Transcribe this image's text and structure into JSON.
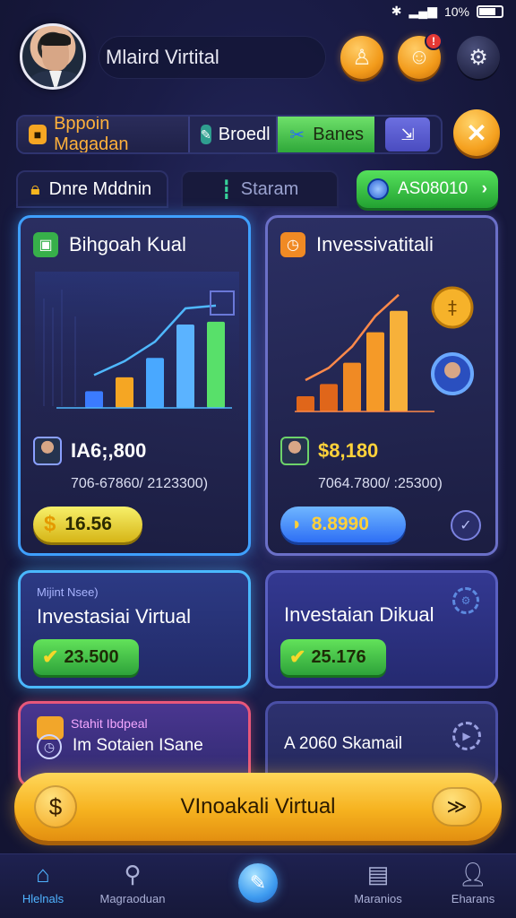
{
  "status_bar": {
    "battery": "10%"
  },
  "header": {
    "username": "Mlaird Virtital",
    "icons": [
      "user-icon",
      "notification-icon",
      "settings-icon"
    ],
    "notification_badge": "!"
  },
  "tabs": [
    {
      "label": "Bppoin Magadan",
      "icon": "home-icon"
    },
    {
      "label": "Broedl",
      "icon": "brush-icon"
    },
    {
      "label": "Banes",
      "icon": "tools-icon"
    },
    {
      "label": "",
      "icon": "chart-icon"
    }
  ],
  "sub_row": {
    "left_label": "Dnre Mddnin",
    "middle_label": "Staram",
    "balance": "AS08010"
  },
  "cards": [
    {
      "title": "Bihgoah Kual",
      "amount": "IA6;,800",
      "range": "706-67860/ 2123300)",
      "pill_value": "16.56",
      "pill_symbol": "$"
    },
    {
      "title": "Invessivatitali",
      "amount": "$8,180",
      "range": "7064.7800/ :25300)",
      "pill_value": "8.8990"
    }
  ],
  "chart_data": [
    {
      "type": "bar",
      "series": [
        {
          "values": [
            12,
            22,
            36,
            60,
            62
          ]
        }
      ],
      "trend": "up",
      "colors": [
        "#3b7bff",
        "#f5a623",
        "#49a8ff",
        "#5bb3ff",
        "#58e06a"
      ]
    },
    {
      "type": "bar",
      "series": [
        {
          "values": [
            10,
            18,
            32,
            52,
            66
          ]
        }
      ],
      "trend": "up",
      "colors": [
        "#e0661a",
        "#e0661a",
        "#f08a24",
        "#f59a28",
        "#f7b13a"
      ]
    }
  ],
  "mid_cards": [
    {
      "caption": "Mijint Nsee)",
      "title": "Investasiai Virtual",
      "value": "23.500"
    },
    {
      "caption": "",
      "title": "Investaian Dikual",
      "value": "25.176"
    }
  ],
  "low_cards": [
    {
      "caption": "Stahit Ibdpeal",
      "title": "Im Sotaien ISane"
    },
    {
      "title": "A 2060 Skamail"
    }
  ],
  "cta": {
    "label": "VInoakali Virtual"
  },
  "bottom_nav": [
    {
      "label": "Hlelnals",
      "icon": "home-icon",
      "active": true
    },
    {
      "label": "Magraoduan",
      "icon": "search-icon"
    },
    {
      "label": "",
      "icon": "feather-icon"
    },
    {
      "label": "Maranios",
      "icon": "inbox-icon"
    },
    {
      "label": "Eharans",
      "icon": "profile-icon"
    }
  ]
}
